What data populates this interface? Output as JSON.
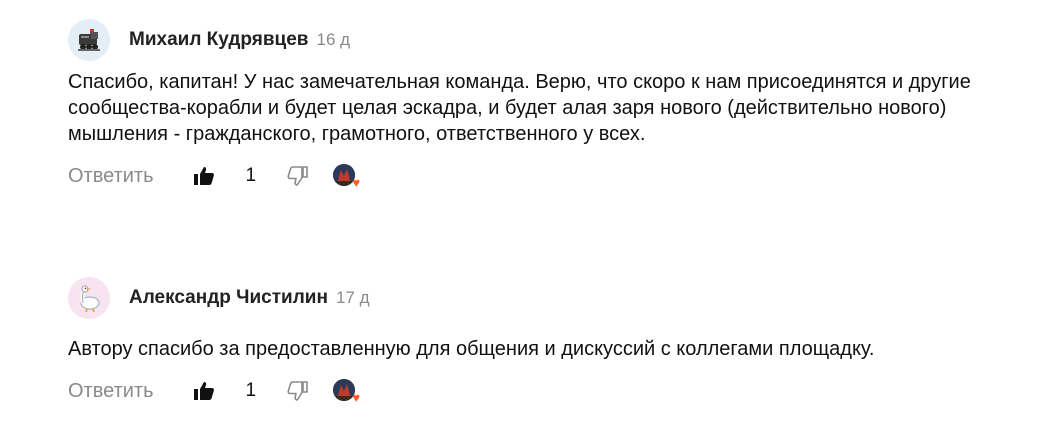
{
  "comments": [
    {
      "author": "Михаил Кудрявцев",
      "age": "16 д",
      "avatar_icon": "steam-locomotive-icon",
      "text": "Спасибо, капитан! У нас замечательная команда. Верю, что скоро к нам присоединятся и другие сообщества-корабли и будет целая эскадра, и будет алая заря нового (действительно нового) мышления - гражданского, грамотного, ответственного у всех.",
      "reply_label": "Ответить",
      "like_count": "1"
    },
    {
      "author": "Александр Чистилин",
      "age": "17 д",
      "avatar_icon": "goose-icon",
      "text": "Автору спасибо за предоставленную для общения и дискуссий с коллегами площадку.",
      "reply_label": "Ответить",
      "like_count": "1"
    }
  ],
  "colors": {
    "muted": "#8a8a8a",
    "heart": "#ff5a1f",
    "avatar1_bg": "#e4eef6",
    "avatar2_bg": "#f7e4f0"
  }
}
